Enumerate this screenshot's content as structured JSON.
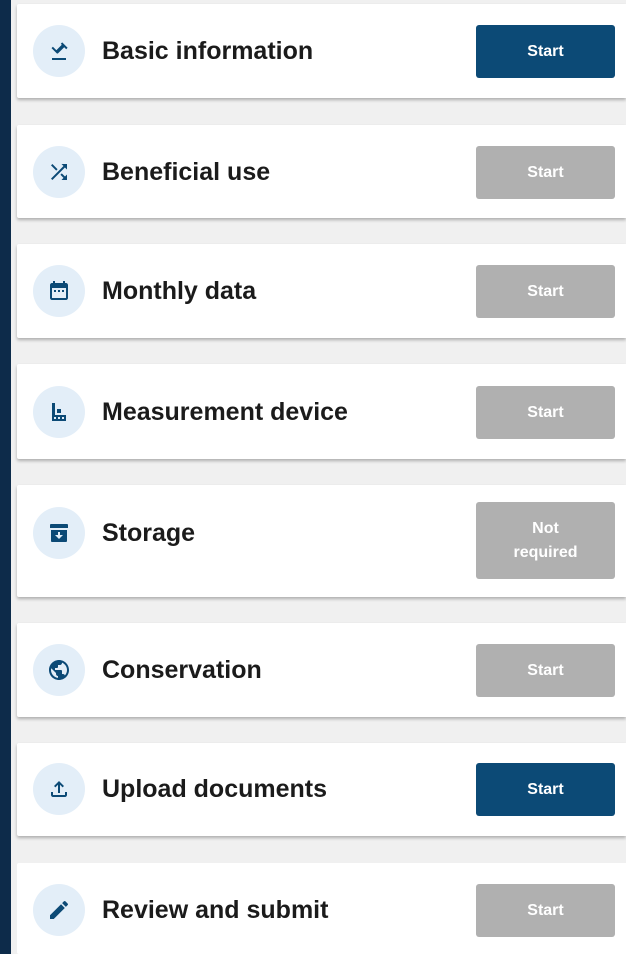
{
  "colors": {
    "sidebar": "#0d2b4a",
    "page_background": "#f0f0f0",
    "card_background": "#ffffff",
    "icon_background": "#e3eef8",
    "icon_color": "#0c4a76",
    "button_active": "#0c4a76",
    "button_disabled": "#b0b0b0"
  },
  "sections": [
    {
      "title": "Basic information",
      "icon": "gavel-icon",
      "button_label": "Start",
      "button_state": "active"
    },
    {
      "title": "Beneficial use",
      "icon": "shuffle-icon",
      "button_label": "Start",
      "button_state": "disabled"
    },
    {
      "title": "Monthly data",
      "icon": "calendar-icon",
      "button_label": "Start",
      "button_state": "disabled"
    },
    {
      "title": "Measurement device",
      "icon": "meter-icon",
      "button_label": "Start",
      "button_state": "disabled"
    },
    {
      "title": "Storage",
      "icon": "archive-icon",
      "button_label": "Not required",
      "button_state": "disabled"
    },
    {
      "title": "Conservation",
      "icon": "globe-icon",
      "button_label": "Start",
      "button_state": "disabled"
    },
    {
      "title": "Upload documents",
      "icon": "upload-icon",
      "button_label": "Start",
      "button_state": "active"
    },
    {
      "title": "Review and submit",
      "icon": "pencil-icon",
      "button_label": "Start",
      "button_state": "disabled"
    }
  ]
}
